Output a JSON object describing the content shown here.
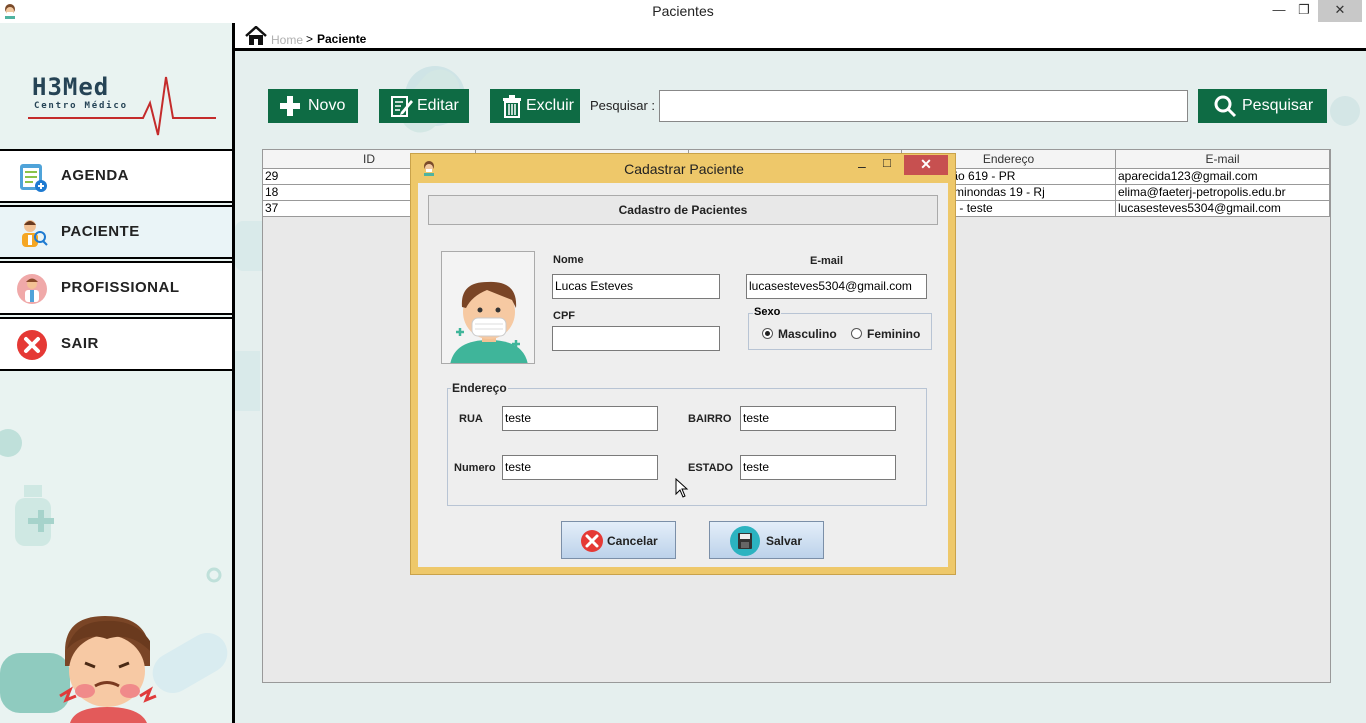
{
  "window": {
    "title": "Pacientes",
    "minimize": "—",
    "maximize": "❐",
    "close": "✕"
  },
  "logo": {
    "name": "H3Med",
    "subtitle": "Centro Médico"
  },
  "sidebar": {
    "items": [
      {
        "label": "AGENDA",
        "icon": "calendar-icon"
      },
      {
        "label": "PACIENTE",
        "icon": "patient-icon"
      },
      {
        "label": "PROFISSIONAL",
        "icon": "doctor-icon"
      },
      {
        "label": "SAIR",
        "icon": "exit-icon"
      }
    ]
  },
  "breadcrumb": {
    "home": "Home",
    "separator": ">",
    "current": "Paciente"
  },
  "toolbar": {
    "novo": "Novo",
    "editar": "Editar",
    "excluir": "Excluir",
    "search_label": "Pesquisar :",
    "search_value": "",
    "pesquisar": "Pesquisar"
  },
  "table": {
    "columns": [
      "ID",
      "Endereço",
      "E-mail"
    ],
    "rows": [
      {
        "id": "29",
        "endereco": "do,  Mourão  619 - PR",
        "email": "aparecida123@gmail.com"
      },
      {
        "id": "18",
        "endereco": "ente, epaminondas 19 - Rj",
        "email": "elima@faeterj-petropolis.edu.br"
      },
      {
        "id": "37",
        "endereco": "este  teste - teste",
        "email": "lucasesteves5304@gmail.com"
      }
    ]
  },
  "dialog": {
    "title": "Cadastrar Paciente",
    "minimize": "–",
    "maximize": "□",
    "close": "✕",
    "header": "Cadastro de Pacientes",
    "nome_label": "Nome",
    "nome_value": "Lucas Esteves",
    "email_label": "E-mail",
    "email_value": "lucasesteves5304@gmail.com",
    "cpf_label": "CPF",
    "cpf_value": "",
    "sexo_label": "Sexo",
    "sexo_options": [
      "Masculino",
      "Feminino"
    ],
    "sexo_selected": "Masculino",
    "endereco_label": "Endereço",
    "rua_label": "RUA",
    "rua_value": "teste",
    "bairro_label": "BAIRRO",
    "bairro_value": "teste",
    "numero_label": "Numero",
    "numero_value": "teste",
    "estado_label": "ESTADO",
    "estado_value": "teste",
    "cancelar": "Cancelar",
    "salvar": "Salvar"
  },
  "colors": {
    "toolbar_green": "#0e6b44",
    "dialog_frame": "#eec86a",
    "close_red": "#c75050",
    "logo_red": "#c42b2b"
  }
}
